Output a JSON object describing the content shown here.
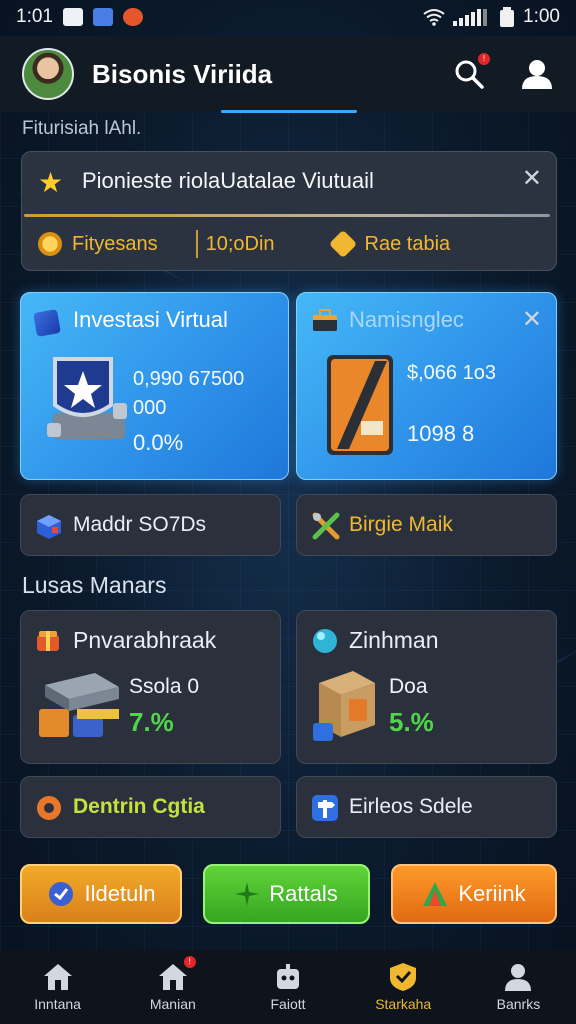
{
  "status_bar": {
    "time_left": "1:01",
    "time_right": "1:00"
  },
  "header": {
    "title": "Bisonis Viriida",
    "search_badge": "!"
  },
  "section_top": "Fiturisiah lAhl.",
  "banner": {
    "title": "Pionieste riolaUatalae Viutuail",
    "stat1": "Fityesans",
    "stat2": "10;oDin",
    "stat3": "Rae tabia"
  },
  "card_investasi": {
    "title": "Investasi Virtual",
    "value_line1": "0,990 67500",
    "value_line2": "000",
    "percent": "0.0%"
  },
  "card_namis": {
    "title": "Namisnglec",
    "value": "$,066 1o3",
    "count": "1098 8"
  },
  "row1": {
    "left": "Maddr SO7Ds",
    "right": "Birgie Maik"
  },
  "section_mid": "Lusas Manars",
  "card_pnvara": {
    "title": "Pnvarabhraak",
    "label": "Ssola 0",
    "percent": "7.%"
  },
  "card_zinh": {
    "title": "Zinhman",
    "label": "Doa",
    "percent": "5.%"
  },
  "row2": {
    "left": "Dentrin Cgtia",
    "right": "Eirleos Sdele"
  },
  "actions": {
    "btn1": "Ildetuln",
    "btn2": "Rattals",
    "btn3": "Keriink"
  },
  "nav": [
    {
      "label": "Inntana",
      "icon": "home-icon"
    },
    {
      "label": "Manian",
      "icon": "home-icon",
      "badge": "!"
    },
    {
      "label": "Faiott",
      "icon": "robot-icon"
    },
    {
      "label": "Starkaha",
      "icon": "shield-icon"
    },
    {
      "label": "Banrks",
      "icon": "person-icon"
    }
  ],
  "colors": {
    "accent_blue": "#3ca7ff",
    "accent_orange": "#f0b830",
    "accent_green": "#4fd64a"
  }
}
